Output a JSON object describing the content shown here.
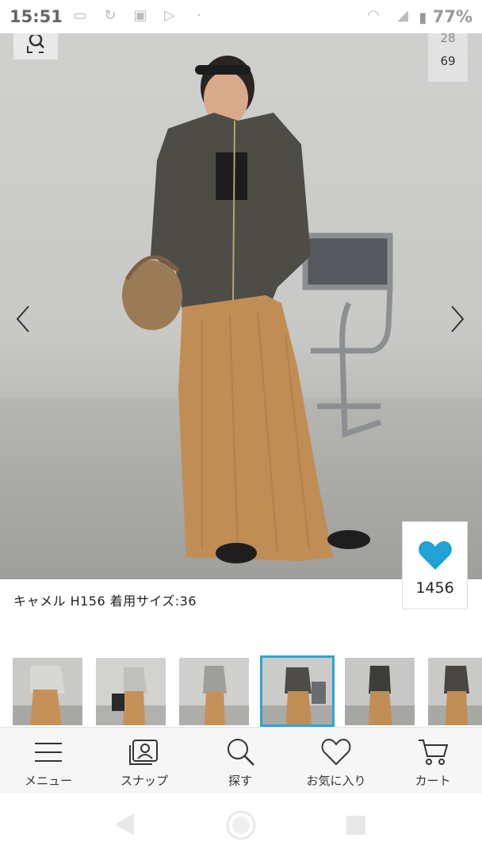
{
  "status_bar": {
    "time": "15:51",
    "battery": "77%"
  },
  "photo": {
    "image_counter": {
      "current": "28",
      "total": "69"
    },
    "caption": "キャメル  H156  着用サイズ:36",
    "favorite_count": "1456"
  },
  "thumbnails": {
    "count": 6,
    "selected_index": 3
  },
  "bottom_nav": {
    "items": [
      {
        "label": "メニュー",
        "icon": "hamburger-menu-icon"
      },
      {
        "label": "スナップ",
        "icon": "snap-photo-icon"
      },
      {
        "label": "探す",
        "icon": "search-icon"
      },
      {
        "label": "お気に入り",
        "icon": "heart-icon"
      },
      {
        "label": "カート",
        "icon": "cart-icon"
      }
    ]
  },
  "colors": {
    "accent": "#29a5d6",
    "heart": "#1fa3d6"
  }
}
